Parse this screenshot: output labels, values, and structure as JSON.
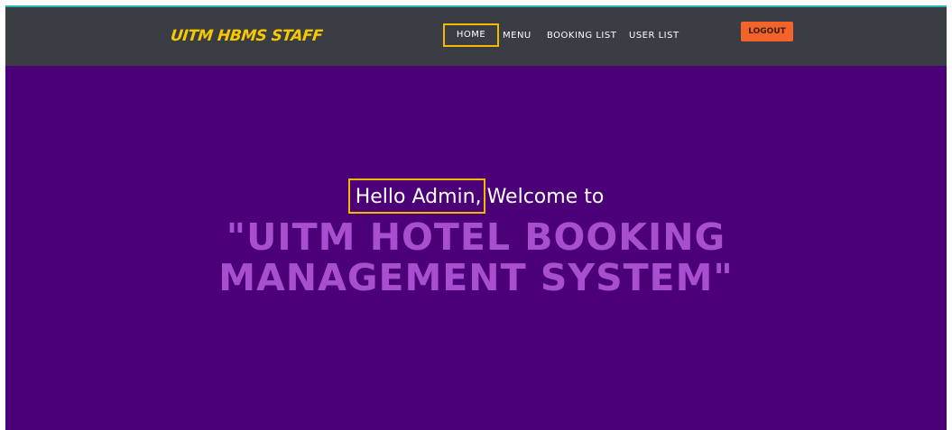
{
  "navbar": {
    "brand": "UITM HBMS STAFF",
    "items": [
      {
        "label": "HOME"
      },
      {
        "label": "MENU"
      },
      {
        "label": "BOOKING LIST"
      },
      {
        "label": "USER LIST"
      }
    ],
    "logout_label": "LOGOUT"
  },
  "hero": {
    "hello": "Hello Admin,",
    "welcome": "Welcome to",
    "title_line1": "\"UITM HOTEL BOOKING",
    "title_line2": "MANAGEMENT SYSTEM\""
  },
  "colors": {
    "navbar_bg": "#3a3d44",
    "hero_bg": "#4b0077",
    "brand": "#f5c800",
    "headline": "#a84fd0",
    "logout": "#f4632a",
    "highlight_box": "#f5b800"
  }
}
